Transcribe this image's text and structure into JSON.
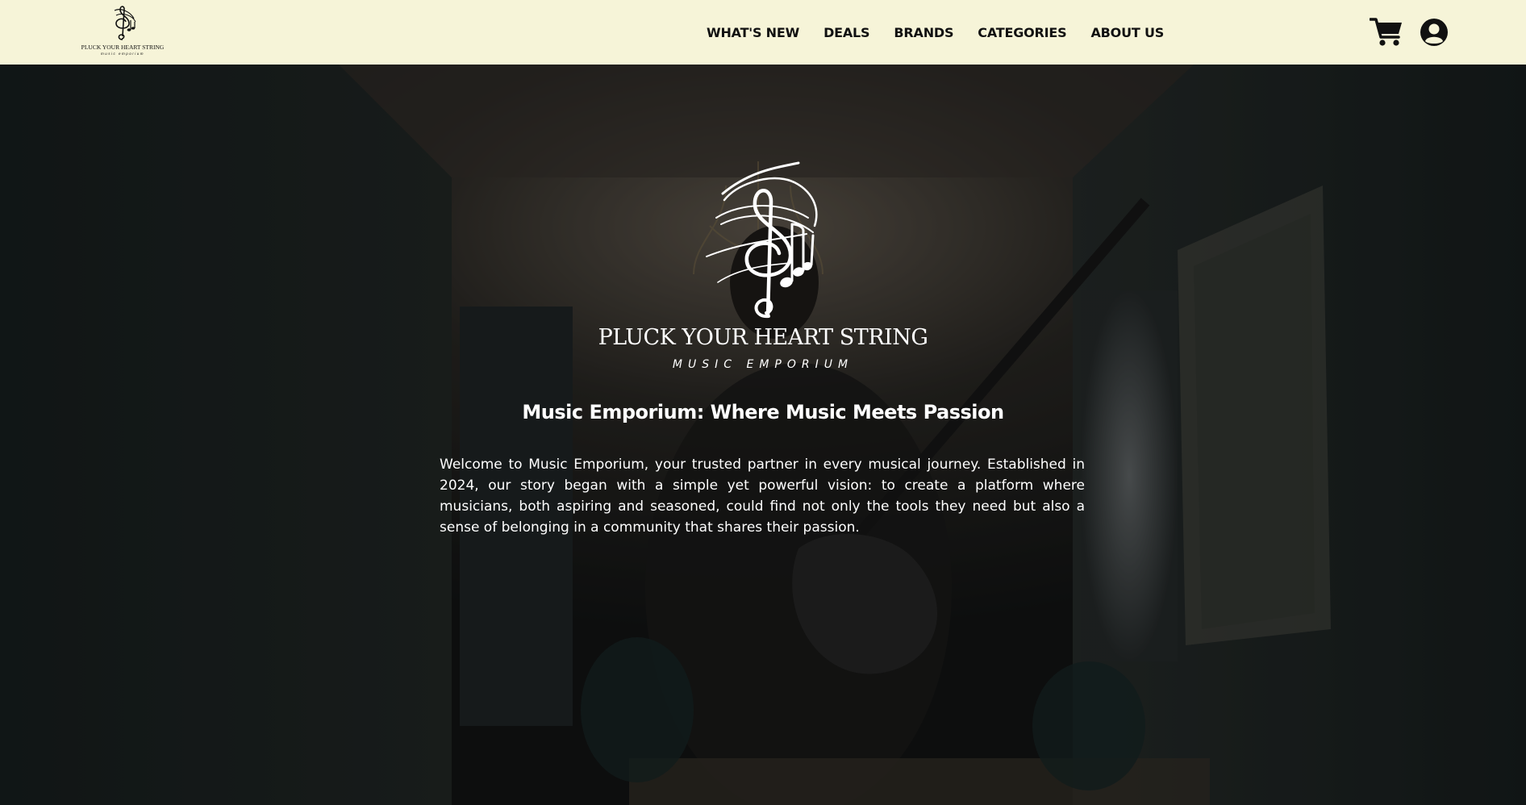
{
  "header": {
    "logo": {
      "title": "PLUCK YOUR HEART STRING",
      "subtitle": "music emporium"
    },
    "nav": [
      {
        "label": "WHAT'S NEW"
      },
      {
        "label": "DEALS"
      },
      {
        "label": "BRANDS"
      },
      {
        "label": "CATEGORIES"
      },
      {
        "label": "ABOUT US"
      }
    ],
    "icons": {
      "cart": "shopping-cart-icon",
      "account": "user-circle-icon"
    }
  },
  "hero": {
    "brand_title": "PLUCK YOUR HEART STRING",
    "brand_subtitle": "MUSIC EMPORIUM",
    "heading": "Music Emporium: Where Music Meets Passion",
    "body": "Welcome to Music Emporium, your trusted partner in every musical journey. Established in 2024, our story began with a simple yet powerful vision: to create a platform where musicians, both aspiring and seasoned, could find not only the tools they need but also a sense of belonging in a community that shares their passion."
  },
  "colors": {
    "header_bg": "#f6f4d8",
    "nav_text": "#111111",
    "hero_text": "#ffffff"
  }
}
